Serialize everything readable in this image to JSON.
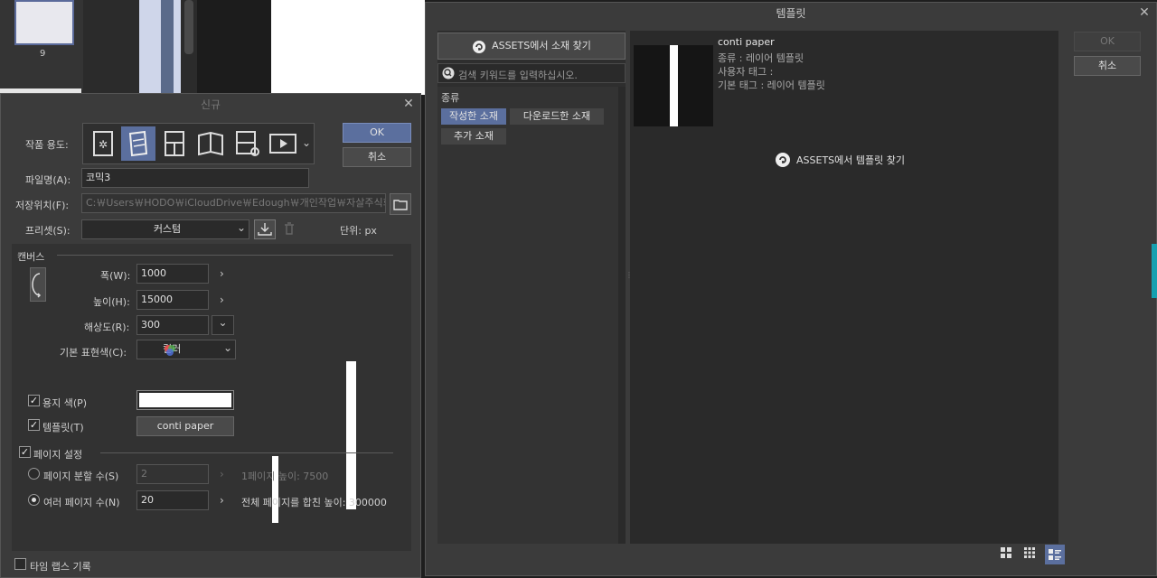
{
  "background": {
    "page_number": "9"
  },
  "new_dialog": {
    "title": "신규",
    "ok_label": "OK",
    "cancel_label": "취소",
    "purpose_label": "작품 용도:",
    "filename_label": "파일명(A):",
    "filename_value": "코믹3",
    "save_location_label": "저장위치(F):",
    "save_location_value": "C:￦Users￦HODO￦iCloudDrive￦Edough￦개인작업￦자살주식회사",
    "preset_label": "프리셋(S):",
    "preset_value": "커스텀",
    "unit_label": "단위: px",
    "canvas_section": "캔버스",
    "width_label": "폭(W):",
    "width_value": "1000",
    "height_label": "높이(H):",
    "height_value": "15000",
    "resolution_label": "해상도(R):",
    "resolution_value": "300",
    "color_label": "기본 표현색(C):",
    "color_value": "컬러",
    "paper_color_label": "용지 색(P)",
    "template_label": "템플릿(T)",
    "template_value": "conti paper",
    "page_settings_label": "페이지 설정",
    "page_split_label": "페이지 분할 수(S)",
    "page_split_value": "2",
    "page_split_info": "1페이지 높이: 7500",
    "multi_page_label": "여러 페이지 수(N)",
    "multi_page_value": "20",
    "multi_page_info": "전체 페이지를 합친 높이: 300000",
    "timelapse_label": "타임 랩스 기록"
  },
  "template_dialog": {
    "title": "템플릿",
    "assets_find_material": "ASSETS에서 소재 찾기",
    "search_placeholder": "검색 키워드를 입력하십시오.",
    "type_label": "종류",
    "tags": [
      "작성한 소재",
      "다운로드한 소재",
      "추가 소재"
    ],
    "item_name": "conti paper",
    "item_type": "종류 : 레이어 템플릿",
    "item_user_tag": "사용자 태그 :",
    "item_base_tag": "기본 태그 : 레이어 템플릿",
    "assets_find_template": "ASSETS에서 템플릿 찾기",
    "ok_label": "OK",
    "cancel_label": "취소"
  },
  "colors": {
    "accent": "#5b6f9e",
    "dialog_bg": "#3b3b3b"
  }
}
